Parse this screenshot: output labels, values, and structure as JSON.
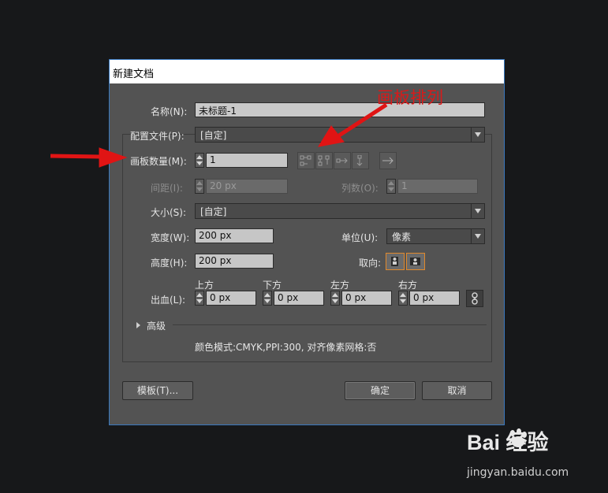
{
  "dialog": {
    "title": "新建文档",
    "name_label": "名称(N):",
    "name_value": "未标题-1",
    "profile_label": "配置文件(P):",
    "profile_value": "[自定]",
    "artboards_label": "画板数量(M):",
    "artboards_value": "1",
    "spacing_label": "间距(I):",
    "spacing_value": "20 px",
    "columns_label": "列数(O):",
    "columns_value": "1",
    "size_label": "大小(S):",
    "size_value": "[自定]",
    "width_label": "宽度(W):",
    "width_value": "200 px",
    "units_label": "单位(U):",
    "units_value": "像素",
    "height_label": "高度(H):",
    "height_value": "200 px",
    "orientation_label": "取向:",
    "bleed_label": "出血(L):",
    "bleed": [
      {
        "label": "上方",
        "value": "0 px"
      },
      {
        "label": "下方",
        "value": "0 px"
      },
      {
        "label": "左方",
        "value": "0 px"
      },
      {
        "label": "右方",
        "value": "0 px"
      }
    ],
    "advanced_label": "高级",
    "color_info": "颜色模式:CMYK,PPI:300, 对齐像素网格:否",
    "templates_button": "模板(T)...",
    "ok_button": "确定",
    "cancel_button": "取消"
  },
  "annotation": {
    "text": "画板排列",
    "color": "#d81a1a"
  },
  "watermark": {
    "logo": "Bai 经验",
    "url": "jingyan.baidu.com"
  }
}
